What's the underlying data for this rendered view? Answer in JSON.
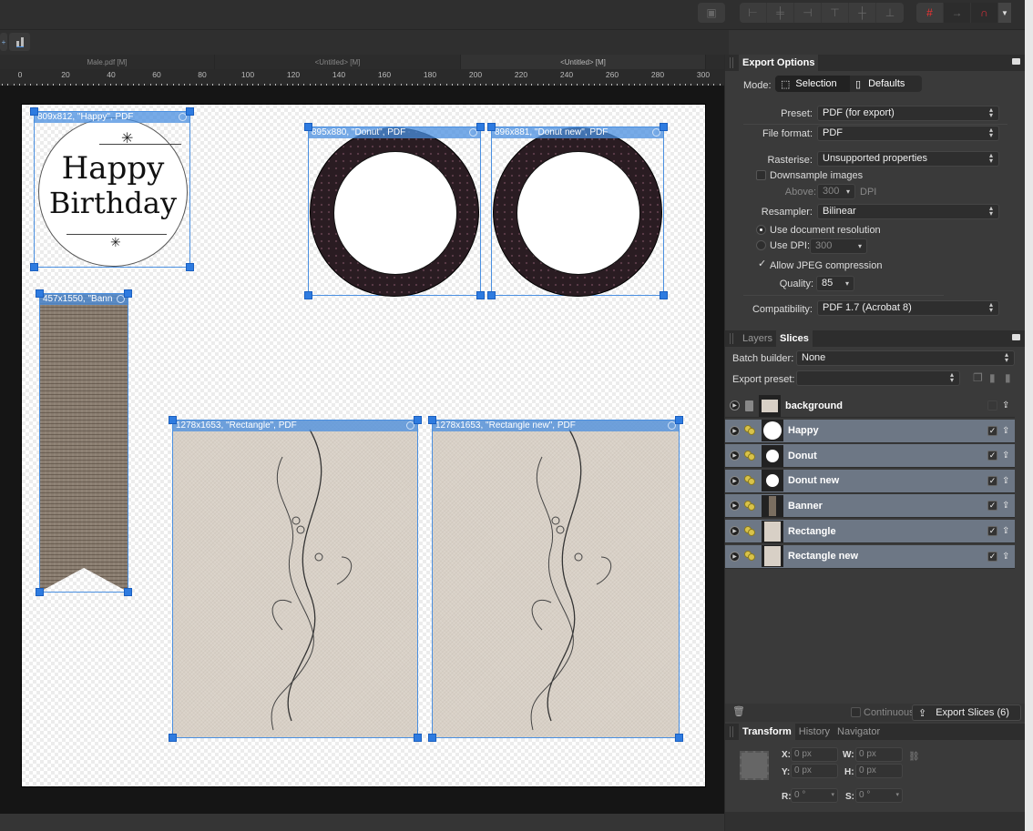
{
  "toolbar": {
    "align_buttons": [
      "align-left",
      "align-center",
      "align-right",
      "align-top",
      "align-middle",
      "align-bottom"
    ],
    "snapping_icon": "snapping-grid-icon",
    "magnet_icon": "magnet-icon"
  },
  "doc_tabs": [
    {
      "label": "Male.pdf [M]",
      "active": false
    },
    {
      "label": "<Untitled> [M]",
      "active": false
    },
    {
      "label": "<Untitled> [M]",
      "active": true
    }
  ],
  "ruler": {
    "labels": [
      "0",
      "20",
      "40",
      "60",
      "80",
      "100",
      "120",
      "140",
      "160",
      "180",
      "200",
      "220",
      "240",
      "260",
      "280",
      "300"
    ]
  },
  "canvas": {
    "slices": [
      {
        "label": "809x812, \"Happy\", PDF",
        "name": "Happy"
      },
      {
        "label": "895x880, \"Donut\", PDF",
        "name": "Donut"
      },
      {
        "label": "896x881, \"Donut new\", PDF",
        "name": "Donut new"
      },
      {
        "label": "457x1550, \"Bann",
        "name": "Banner"
      },
      {
        "label": "1278x1653, \"Rectangle\", PDF",
        "name": "Rectangle"
      },
      {
        "label": "1278x1653, \"Rectangle new\", PDF",
        "name": "Rectangle new"
      }
    ],
    "happy_line1": "Happy",
    "happy_line2": "Birthday"
  },
  "export_options": {
    "title": "Export Options",
    "mode_label": "Mode:",
    "mode_selection": "Selection",
    "mode_defaults": "Defaults",
    "preset_label": "Preset:",
    "preset_value": "PDF (for export)",
    "format_label": "File format:",
    "format_value": "PDF",
    "rasterise_label": "Rasterise:",
    "rasterise_value": "Unsupported properties",
    "downsample_label": "Downsample images",
    "downsample_checked": false,
    "above_label": "Above:",
    "above_value": "300",
    "dpi_label": "DPI",
    "resampler_label": "Resampler:",
    "resampler_value": "Bilinear",
    "use_doc_res_label": "Use document resolution",
    "use_dpi_label": "Use DPI:",
    "use_dpi_value": "300",
    "allow_jpeg_label": "Allow JPEG compression",
    "allow_jpeg_checked": true,
    "quality_label": "Quality:",
    "quality_value": "85",
    "compat_label": "Compatibility:",
    "compat_value": "PDF 1.7 (Acrobat 8)"
  },
  "slices_panel": {
    "tab_layers": "Layers",
    "tab_slices": "Slices",
    "batch_label": "Batch builder:",
    "batch_value": "None",
    "preset_label": "Export preset:",
    "preset_value": "",
    "rows": [
      {
        "name": "background",
        "selected": false,
        "checked": false
      },
      {
        "name": "Happy",
        "selected": true,
        "checked": true
      },
      {
        "name": "Donut",
        "selected": true,
        "checked": true
      },
      {
        "name": "Donut new",
        "selected": true,
        "checked": true
      },
      {
        "name": "Banner",
        "selected": true,
        "checked": true
      },
      {
        "name": "Rectangle",
        "selected": true,
        "checked": true
      },
      {
        "name": "Rectangle new",
        "selected": true,
        "checked": true
      }
    ],
    "continuous_label": "Continuous",
    "export_button": "Export Slices (6)"
  },
  "transform_panel": {
    "tab_transform": "Transform",
    "tab_history": "History",
    "tab_navigator": "Navigator",
    "x_label": "X:",
    "x_value": "0 px",
    "y_label": "Y:",
    "y_value": "0 px",
    "w_label": "W:",
    "w_value": "0 px",
    "h_label": "H:",
    "h_value": "0 px",
    "r_label": "R:",
    "r_value": "0 °",
    "s_label": "S:",
    "s_value": "0 °"
  }
}
